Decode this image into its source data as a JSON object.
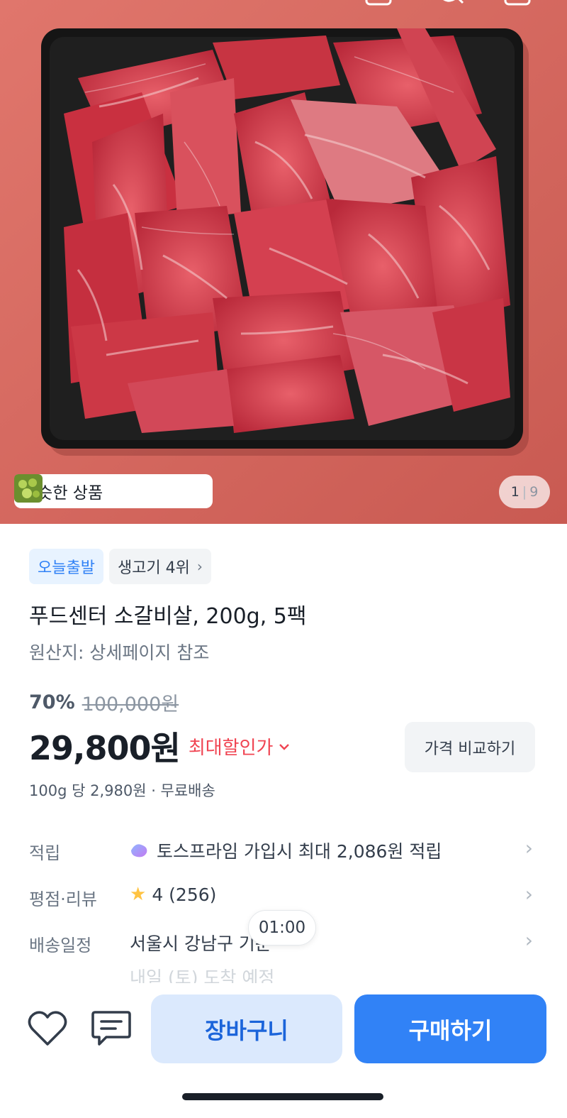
{
  "gallery": {
    "image_alt": "소갈비살",
    "similar_products_label": "비슷한 상품",
    "current_page": "1",
    "total_pages": "9",
    "page_separator": "|"
  },
  "badges": {
    "today_ship": "오늘출발",
    "ranking": "생고기 4위"
  },
  "product": {
    "title": "푸드센터 소갈비살, 200g, 5팩",
    "origin": "원산지: 상세페이지 참조",
    "discount_rate": "70%",
    "original_price": "100,000원",
    "price": "29,800원",
    "max_discount_label": "최대할인가",
    "compare_button": "가격 비교하기",
    "unit_price": "100g 당 2,980원 · 무료배송"
  },
  "details": {
    "points_label": "적립",
    "points_value": "토스프라임 가입시 최대 2,086원 적립",
    "rating_label": "평점·리뷰",
    "rating_value": "4 (256)",
    "delivery_label": "배송일정",
    "delivery_value": "서울시 강남구 기준",
    "delivery_subline": "내일 (토) 도착 예정",
    "time_bubble": "01:00"
  },
  "actions": {
    "cart_button": "장바구니",
    "buy_button": "구매하기"
  },
  "colors": {
    "accent": "#3182f6",
    "discount_red": "#f04452",
    "cart_bg": "#dbe9fd",
    "star": "#ffc342"
  }
}
